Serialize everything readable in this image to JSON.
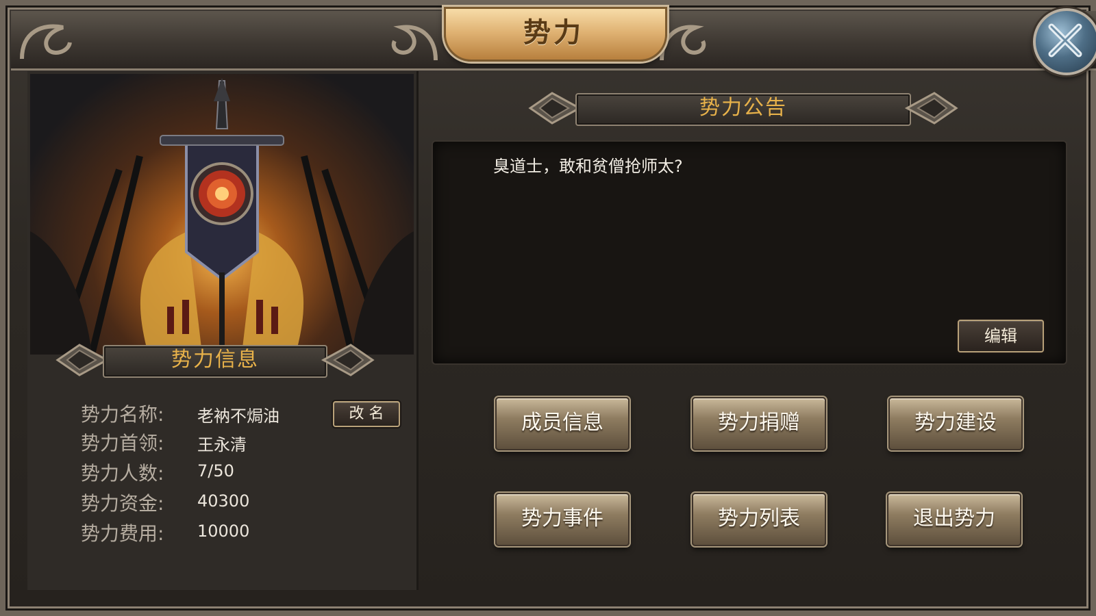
{
  "window": {
    "title": "势力"
  },
  "left": {
    "section_title": "势力信息",
    "rows": [
      {
        "label": "势力名称:",
        "value": "老衲不焗油"
      },
      {
        "label": "势力首领:",
        "value": "王永清"
      },
      {
        "label": "势力人数:",
        "value": "7/50"
      },
      {
        "label": "势力资金:",
        "value": "40300"
      },
      {
        "label": "势力费用:",
        "value": "10000"
      }
    ],
    "rename_label": "改 名"
  },
  "right": {
    "section_title": "势力公告",
    "notice_text": "臭道士，敢和贫僧抢师太?",
    "edit_label": "编辑",
    "buttons": [
      {
        "label": "成员信息"
      },
      {
        "label": "势力捐赠"
      },
      {
        "label": "势力建设"
      },
      {
        "label": "势力事件"
      },
      {
        "label": "势力列表"
      },
      {
        "label": "退出势力"
      }
    ]
  },
  "icons": {
    "close": "close-x-icon",
    "emblem": "faction-banner-emblem",
    "arrow": "ornate-arrow-icon"
  },
  "colors": {
    "gold_text": "#e8b24a",
    "title_plate": "#e0b374",
    "panel_bg": "#2f2b27",
    "notice_bg": "#181512"
  }
}
